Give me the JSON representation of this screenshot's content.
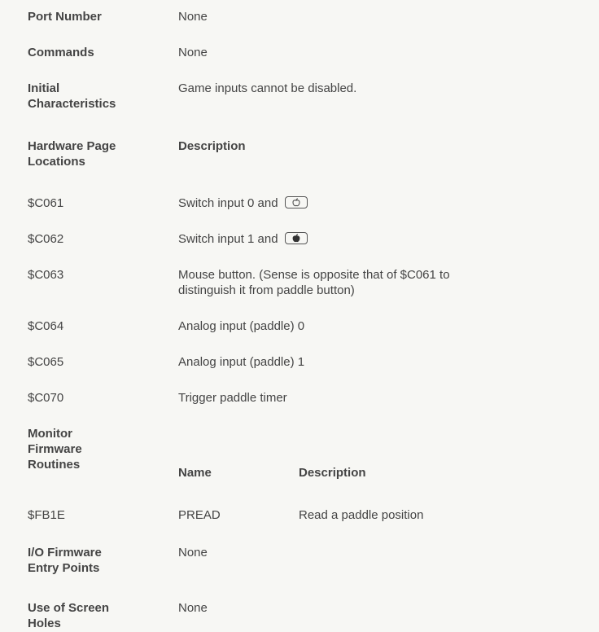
{
  "port": {
    "label": "Port Number",
    "value": "None"
  },
  "commands": {
    "label": "Commands",
    "value": "None"
  },
  "initial": {
    "label_line1": "Initial",
    "label_line2": "Characteristics",
    "value": "Game inputs cannot be disabled."
  },
  "hardware": {
    "label_line1": "Hardware Page",
    "label_line2": "Locations",
    "col_header": "Description",
    "rows": [
      {
        "addr": "$C061",
        "desc": "Switch input 0 and",
        "key_icon": "open-apple-icon"
      },
      {
        "addr": "$C062",
        "desc": "Switch input 1 and",
        "key_icon": "solid-apple-icon"
      },
      {
        "addr": "$C063",
        "desc_line1": "Mouse button. (Sense is opposite that of $C061 to",
        "desc_line2": "distinguish it from paddle button)"
      },
      {
        "addr": "$C064",
        "desc": "Analog input (paddle) 0"
      },
      {
        "addr": "$C065",
        "desc": "Analog input (paddle) 1"
      },
      {
        "addr": "$C070",
        "desc": "Trigger paddle timer"
      }
    ]
  },
  "monitor": {
    "label_line1": "Monitor",
    "label_line2": "Firmware",
    "label_line3": "Routines",
    "col_name": "Name",
    "col_desc": "Description",
    "rows": [
      {
        "addr": "$FB1E",
        "name": "PREAD",
        "desc": "Read a paddle position"
      }
    ]
  },
  "io": {
    "label_line1": "I/O Firmware",
    "label_line2": "Entry Points",
    "value": "None"
  },
  "screen": {
    "label_line1": "Use of Screen",
    "label_line2": "Holes",
    "value": "None"
  }
}
